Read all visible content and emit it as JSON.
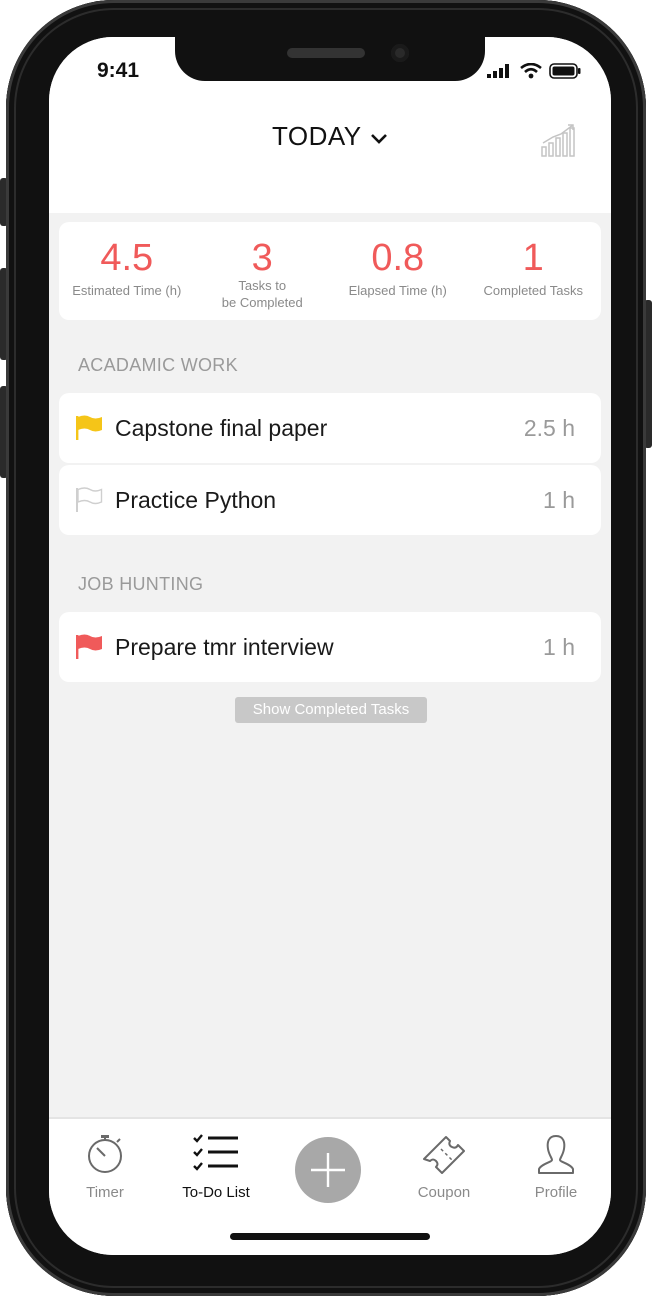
{
  "status_bar": {
    "time": "9:41"
  },
  "header": {
    "title": "TODAY"
  },
  "stats": [
    {
      "value": "4.5",
      "label": "Estimated Time (h)"
    },
    {
      "value": "3",
      "label_line1": "Tasks to",
      "label_line2": "be Completed"
    },
    {
      "value": "0.8",
      "label": "Elapsed Time (h)"
    },
    {
      "value": "1",
      "label": "Completed Tasks"
    }
  ],
  "sections": [
    {
      "title": "ACADAMIC WORK",
      "tasks": [
        {
          "name": "Capstone final paper",
          "hours": "2.5 h",
          "flag": "yellow-flag-icon",
          "flag_color": "#f5c518"
        },
        {
          "name": "Practice Python",
          "hours": "1 h",
          "flag": "empty-flag-icon",
          "flag_color": "#cfcfcf"
        }
      ]
    },
    {
      "title": "JOB HUNTING",
      "tasks": [
        {
          "name": "Prepare tmr interview",
          "hours": "1 h",
          "flag": "red-flag-icon",
          "flag_color": "#f05a5a"
        }
      ]
    }
  ],
  "show_completed_label": "Show Completed Tasks",
  "tabs": [
    {
      "label": "Timer",
      "icon": "stopwatch-icon"
    },
    {
      "label": "To-Do List",
      "icon": "checklist-icon",
      "active": true
    },
    {
      "label": "",
      "icon": "plus-icon"
    },
    {
      "label": "Coupon",
      "icon": "ticket-icon"
    },
    {
      "label": "Profile",
      "icon": "person-icon"
    }
  ],
  "colors": {
    "accent": "#f05a5a",
    "background": "#f2f2f2",
    "card": "#ffffff",
    "muted": "#9a9a9a"
  }
}
